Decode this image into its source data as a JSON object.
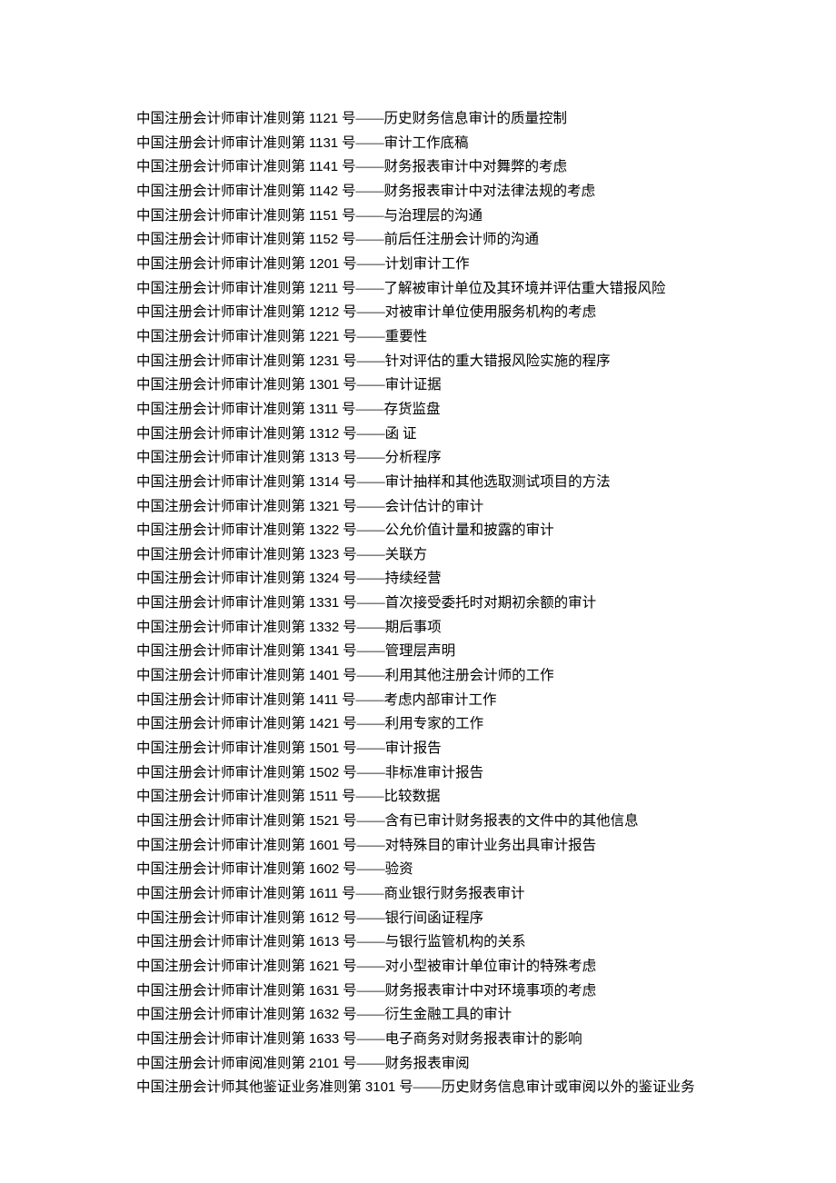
{
  "prefix_audit": "中国注册会计师审计准则第 ",
  "prefix_review": "中国注册会计师审阅准则第 ",
  "prefix_other": "中国注册会计师其他鉴证业务准则第 ",
  "hao": " 号——",
  "items": [
    {
      "type": "audit",
      "num": "1121",
      "title": "历史财务信息审计的质量控制"
    },
    {
      "type": "audit",
      "num": "1131",
      "title": "审计工作底稿"
    },
    {
      "type": "audit",
      "num": "1141",
      "title": "财务报表审计中对舞弊的考虑"
    },
    {
      "type": "audit",
      "num": "1142",
      "title": "财务报表审计中对法律法规的考虑"
    },
    {
      "type": "audit",
      "num": "1151",
      "title": "与治理层的沟通"
    },
    {
      "type": "audit",
      "num": "1152",
      "title": "前后任注册会计师的沟通"
    },
    {
      "type": "audit",
      "num": "1201",
      "title": "计划审计工作"
    },
    {
      "type": "audit",
      "num": "1211",
      "title": "了解被审计单位及其环境并评估重大错报风险"
    },
    {
      "type": "audit",
      "num": "1212",
      "title": "对被审计单位使用服务机构的考虑"
    },
    {
      "type": "audit",
      "num": "1221",
      "title": "重要性"
    },
    {
      "type": "audit",
      "num": "1231",
      "title": "针对评估的重大错报风险实施的程序"
    },
    {
      "type": "audit",
      "num": "1301",
      "title": "审计证据"
    },
    {
      "type": "audit",
      "num": "1311",
      "title": "存货监盘"
    },
    {
      "type": "audit",
      "num": "1312",
      "title": "函  证"
    },
    {
      "type": "audit",
      "num": "1313",
      "title": "分析程序"
    },
    {
      "type": "audit",
      "num": "1314",
      "title": "审计抽样和其他选取测试项目的方法"
    },
    {
      "type": "audit",
      "num": "1321",
      "title": "会计估计的审计"
    },
    {
      "type": "audit",
      "num": "1322",
      "title": "公允价值计量和披露的审计"
    },
    {
      "type": "audit",
      "num": "1323",
      "title": "关联方"
    },
    {
      "type": "audit",
      "num": "1324",
      "title": "持续经营"
    },
    {
      "type": "audit",
      "num": "1331",
      "title": "首次接受委托时对期初余额的审计"
    },
    {
      "type": "audit",
      "num": "1332",
      "title": "期后事项"
    },
    {
      "type": "audit",
      "num": "1341",
      "title": "管理层声明"
    },
    {
      "type": "audit",
      "num": "1401",
      "title": "利用其他注册会计师的工作"
    },
    {
      "type": "audit",
      "num": "1411",
      "title": "考虑内部审计工作"
    },
    {
      "type": "audit",
      "num": "1421",
      "title": "利用专家的工作"
    },
    {
      "type": "audit",
      "num": "1501",
      "title": "审计报告"
    },
    {
      "type": "audit",
      "num": "1502",
      "title": "非标准审计报告"
    },
    {
      "type": "audit",
      "num": "1511",
      "title": "比较数据"
    },
    {
      "type": "audit",
      "num": "1521",
      "title": "含有已审计财务报表的文件中的其他信息"
    },
    {
      "type": "audit",
      "num": "1601",
      "title": "对特殊目的审计业务出具审计报告"
    },
    {
      "type": "audit",
      "num": "1602",
      "title": "验资"
    },
    {
      "type": "audit",
      "num": "1611",
      "title": "商业银行财务报表审计"
    },
    {
      "type": "audit",
      "num": "1612",
      "title": "银行间函证程序"
    },
    {
      "type": "audit",
      "num": "1613",
      "title": "与银行监管机构的关系"
    },
    {
      "type": "audit",
      "num": "1621",
      "title": "对小型被审计单位审计的特殊考虑"
    },
    {
      "type": "audit",
      "num": "1631",
      "title": "财务报表审计中对环境事项的考虑"
    },
    {
      "type": "audit",
      "num": "1632",
      "title": "衍生金融工具的审计"
    },
    {
      "type": "audit",
      "num": "1633",
      "title": "电子商务对财务报表审计的影响"
    },
    {
      "type": "review",
      "num": "2101",
      "title": "财务报表审阅"
    },
    {
      "type": "other",
      "num": "3101",
      "title": "历史财务信息审计或审阅以外的鉴证业务"
    }
  ]
}
